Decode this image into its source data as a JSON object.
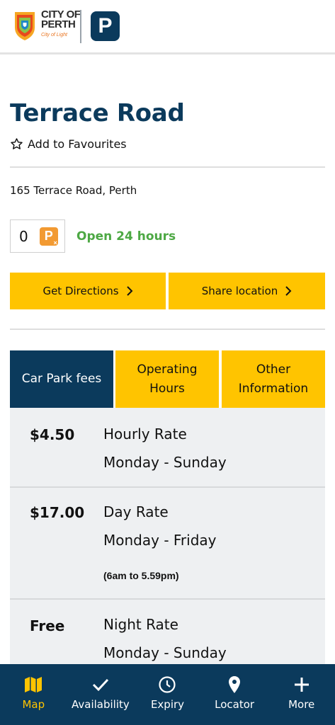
{
  "header": {
    "logo_line1": "CITY OF",
    "logo_line2": "PERTH",
    "logo_tagline": "City of Light",
    "parking_badge": "P"
  },
  "carpark": {
    "title": "Terrace Road",
    "favourites_label": "Add to Favourites",
    "address": "165 Terrace Road, Perth",
    "available_count": "0",
    "availability_icon": "parking-unavailable-icon",
    "hours_status": "Open 24 hours",
    "hours_status_color": "#4da844"
  },
  "actions": {
    "directions_label": "Get Directions",
    "share_label": "Share location"
  },
  "tabs": [
    {
      "label": "Car Park fees",
      "active": true
    },
    {
      "label": "Operating\nHours",
      "active": false
    },
    {
      "label": "Other\nInformation",
      "active": false
    }
  ],
  "fees": [
    {
      "price": "$4.50",
      "name": "Hourly Rate",
      "days": "Monday - Sunday",
      "note": ""
    },
    {
      "price": "$17.00",
      "name": "Day Rate",
      "days": "Monday - Friday",
      "note": "(6am to 5.59pm)"
    },
    {
      "price": "Free",
      "name": "Night Rate",
      "days": "Monday - Sunday",
      "note": ""
    }
  ],
  "nav": [
    {
      "label": "Map",
      "icon": "map-icon",
      "active": true
    },
    {
      "label": "Availability",
      "icon": "check-icon",
      "active": false
    },
    {
      "label": "Expiry",
      "icon": "clock-icon",
      "active": false
    },
    {
      "label": "Locator",
      "icon": "location-pin-icon",
      "active": false
    },
    {
      "label": "More",
      "icon": "plus-icon",
      "active": false
    }
  ],
  "colors": {
    "brand_navy": "#0b3a5c",
    "accent_yellow": "#ffc400",
    "open_green": "#4da844",
    "parking_orange": "#f29a32"
  }
}
